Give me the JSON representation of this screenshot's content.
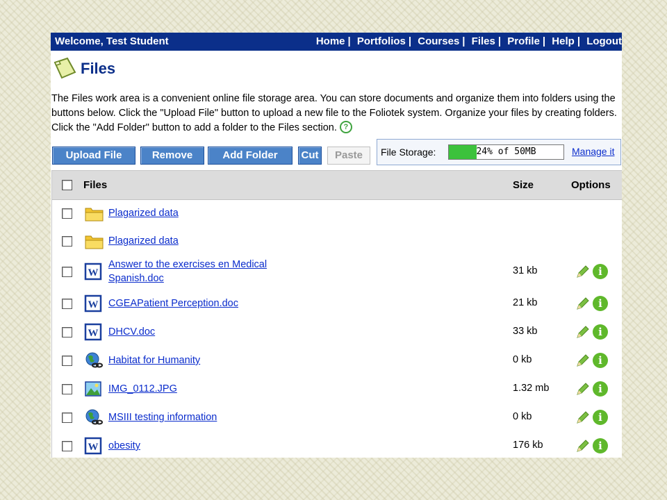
{
  "topbar": {
    "welcome": "Welcome, Test Student",
    "nav": [
      "Home",
      "Portfolios",
      "Courses",
      "Files",
      "Profile",
      "Help",
      "Logout"
    ],
    "separator": "|"
  },
  "page": {
    "title": "Files",
    "intro": "The Files work area is a convenient online file storage area. You can store documents and organize them into folders using the buttons below. Click the \"Upload File\" button to upload a new file to the Foliotek system. Organize your files by creating folders. Click the \"Add Folder\" button to add a folder to the Files section.",
    "help_icon": "?"
  },
  "toolbar": {
    "upload": "Upload File",
    "remove": "Remove",
    "add_folder": "Add Folder",
    "cut": "Cut",
    "paste": "Paste"
  },
  "storage": {
    "label": "File Storage:",
    "text": "24% of 50MB",
    "percent": 24,
    "manage": "Manage it"
  },
  "list": {
    "headers": {
      "files": "Files",
      "size": "Size",
      "options": "Options"
    },
    "rows": [
      {
        "name": "Plagarized data",
        "icon": "folder-icon",
        "size": ""
      },
      {
        "name": "Plagarized data",
        "icon": "folder-icon",
        "size": ""
      },
      {
        "name": "Answer to the exercises en Medical Spanish.doc",
        "icon": "word-doc-icon",
        "size": "31 kb"
      },
      {
        "name": "CGEAPatient Perception.doc",
        "icon": "word-doc-icon",
        "size": "21 kb"
      },
      {
        "name": "DHCV.doc",
        "icon": "word-doc-icon",
        "size": "33 kb"
      },
      {
        "name": "Habitat for Humanity",
        "icon": "web-link-icon",
        "size": "0 kb"
      },
      {
        "name": "IMG_0112.JPG",
        "icon": "image-file-icon",
        "size": "1.32 mb"
      },
      {
        "name": "MSIII testing information",
        "icon": "web-link-icon",
        "size": "0 kb"
      },
      {
        "name": "obesity",
        "icon": "word-doc-icon",
        "size": "176 kb"
      }
    ]
  },
  "colors": {
    "nav_bg": "#0b2f8a",
    "button_bg": "#4b83c8",
    "link": "#0a2ccc",
    "storage_fill": "#3cc23c",
    "info": "#5fb82b"
  }
}
